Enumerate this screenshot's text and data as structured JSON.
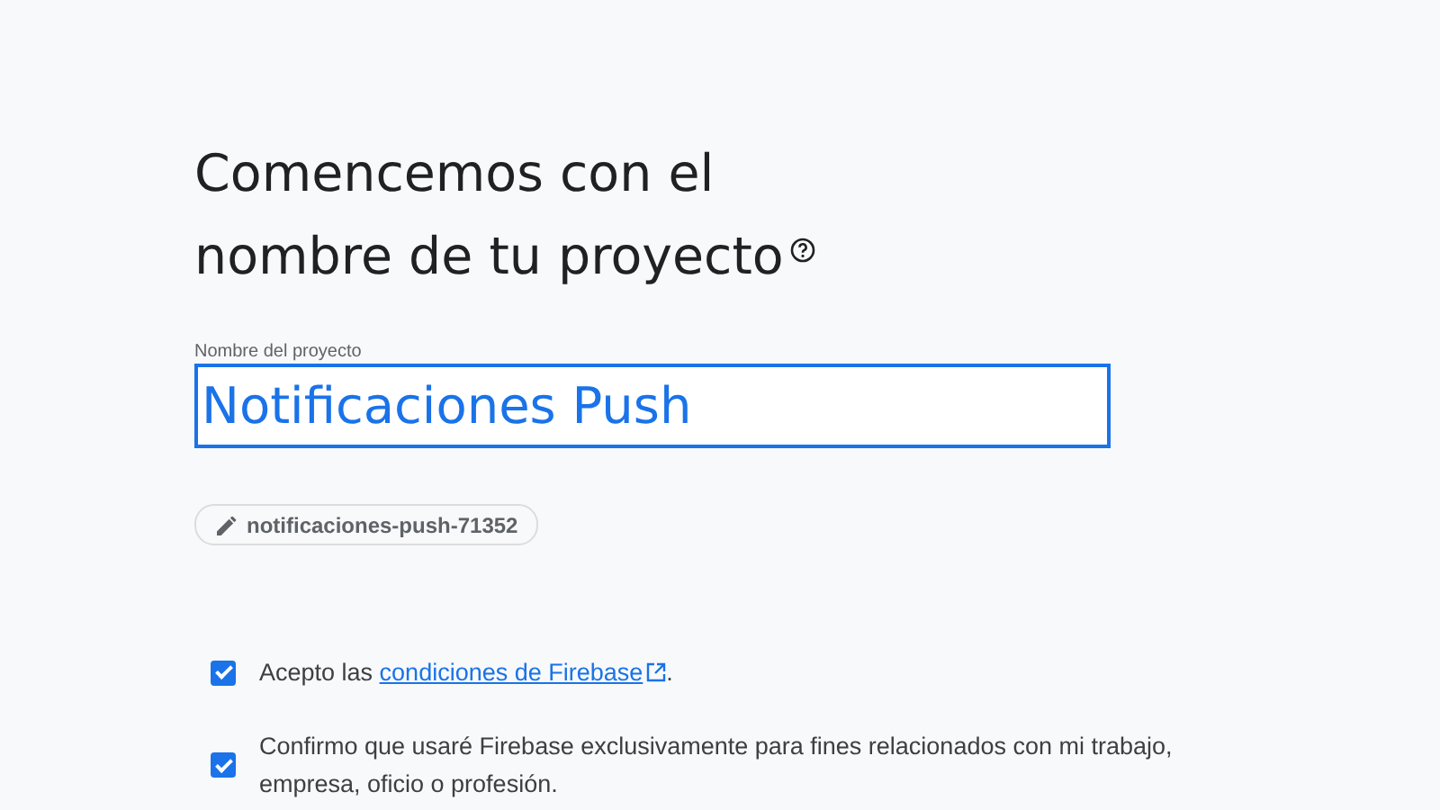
{
  "heading": {
    "line_1": "Comencemos con el",
    "line_2": "nombre de tu proyecto"
  },
  "project_name_field": {
    "label": "Nombre del proyecto",
    "value": "Notificaciones Push",
    "focused": true
  },
  "project_id_chip": {
    "text": "notificaciones-push-71352"
  },
  "agreements": [
    {
      "checked": true,
      "before": "Acepto las ",
      "link": "condiciones de Firebase",
      "after": "."
    },
    {
      "checked": true,
      "before": "Confirmo que usaré Firebase exclusivamente para fines relacionados con mi trabajo, empresa, oficio o profesión."
    }
  ]
}
